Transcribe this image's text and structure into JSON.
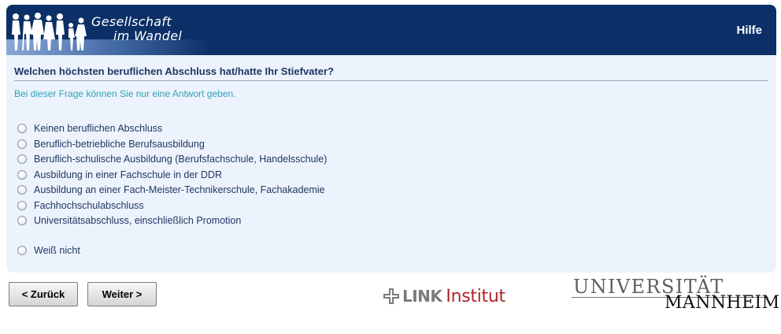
{
  "header": {
    "logo_line1": "Gesellschaft",
    "logo_line2": "im Wandel",
    "help_label": "Hilfe"
  },
  "question": {
    "text": "Welchen höchsten beruflichen Abschluss hat/hatte Ihr Stiefvater?",
    "hint": "Bei dieser Frage können Sie nur eine Antwort geben."
  },
  "answers": [
    {
      "label": "Keinen beruflichen Abschluss",
      "selected": false
    },
    {
      "label": "Beruflich-betriebliche Berufsausbildung",
      "selected": false
    },
    {
      "label": "Beruflich-schulische Ausbildung (Berufsfachschule, Handelsschule)",
      "selected": false
    },
    {
      "label": "Ausbildung in einer Fachschule in der DDR",
      "selected": false
    },
    {
      "label": "Ausbildung an einer Fach-Meister-Technikerschule, Fachakademie",
      "selected": false
    },
    {
      "label": "Fachhochschulabschluss",
      "selected": false
    },
    {
      "label": "Universitätsabschluss, einschließlich Promotion",
      "selected": false
    },
    {
      "label": "Weiß nicht",
      "selected": false
    }
  ],
  "navigation": {
    "back_label": "< Zurück",
    "next_label": "Weiter >"
  },
  "logos": {
    "link_word": "LINK",
    "link_institut": "Institut",
    "uni_top": "UNIVERSITÄT",
    "uni_bottom": "MANNHEIM"
  },
  "colors": {
    "header_bg": "#0b2f66",
    "panel_bg": "#edf3fc",
    "question_text": "#1f3763",
    "hint_text": "#2fa0b8",
    "link_red": "#b3232b"
  }
}
